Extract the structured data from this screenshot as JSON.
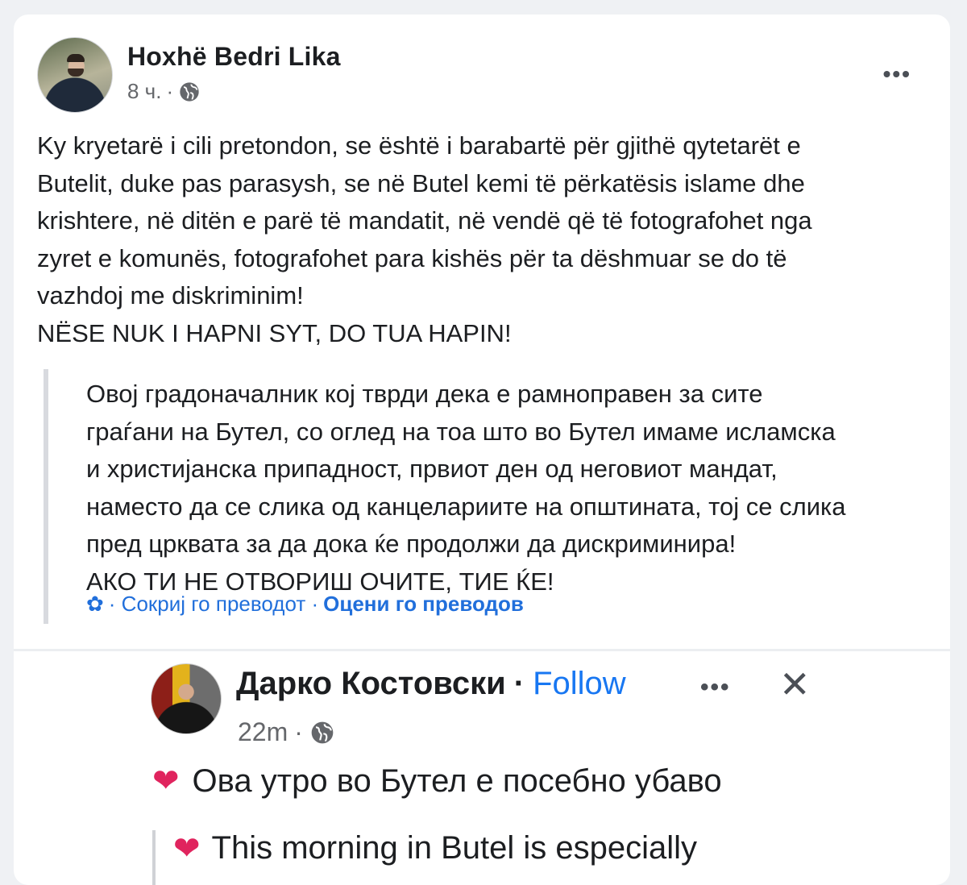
{
  "post": {
    "author": "Hoxhë Bedri Lika",
    "time": "8 ч.",
    "time_sep": "·",
    "audience_icon": "globe-icon",
    "more_label": "•••",
    "text_lines": [
      "Ky kryetarë i cili pretondon, se është i barabartë për gjithë qytetarët e",
      "Butelit, duke pas parasysh, se në Butel kemi të përkatësis islame dhe",
      "krishtere, në ditën e parë të mandatit, në vendë që të fotografohet nga",
      "zyret e komunës, fotografohet para kishës për ta dëshmuar se do të",
      "vazhdoj me diskriminim!",
      "NËSE NUK I HAPNI SYT, DO TUA HAPIN!"
    ],
    "translation_lines": [
      "Овој градоначалник кој тврди дека е рамноправен за сите",
      "граѓани на Бутел, со оглед на тоа што во Бутел имаме исламска",
      "и христијанска припадност, првиот ден од неговиот мандат,",
      "наместо да се слика од канцелариите на општината, тој се слика",
      "пред црквата за да дока ќе продолжи да дискриминира!",
      "АКО ТИ НЕ ОТВОРИШ ОЧИТЕ, ТИЕ ЌЕ!"
    ],
    "translation_links": {
      "gear_icon": "gear-icon",
      "hide": "· Сокриј го преводот ·",
      "rate": "Оцени го преводов"
    }
  },
  "shared": {
    "author": "Дарко Костовски",
    "dot": "·",
    "follow": "Follow",
    "more_label": "•••",
    "close_label": "✕",
    "time": "22m",
    "time_sep": "·",
    "text": "Ова утро во Бутел е посебно убаво",
    "quote_text": "This morning in Butel is especially",
    "heart_icon": "heart-icon"
  },
  "colors": {
    "link": "#216fdb",
    "follow": "#1877f2",
    "heart": "#e0245e",
    "muted": "#65676b"
  }
}
